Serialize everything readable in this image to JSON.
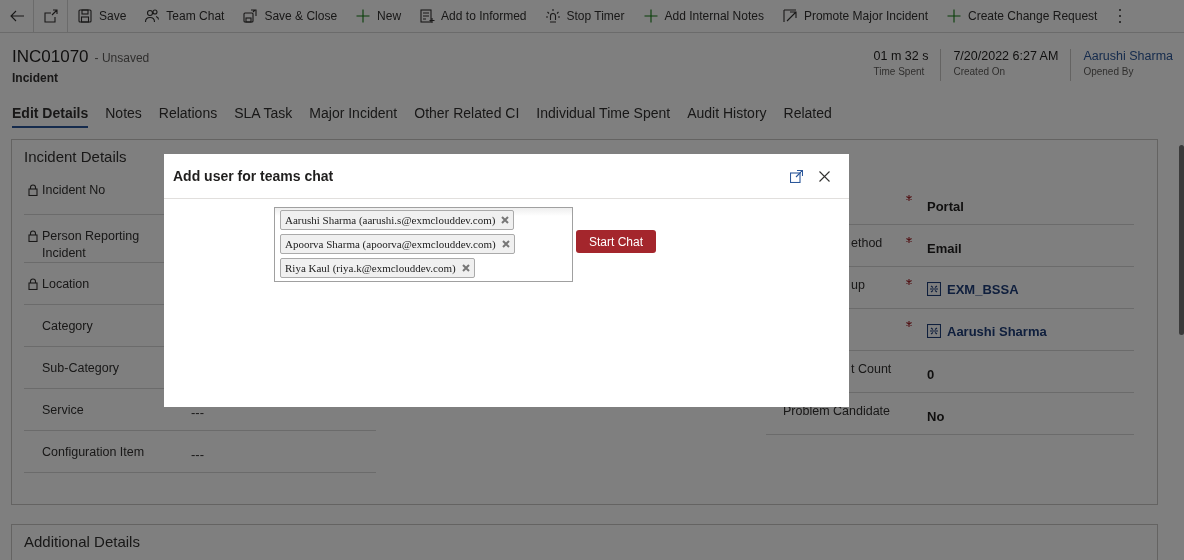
{
  "toolbar": {
    "items": [
      {
        "label": "Save"
      },
      {
        "label": "Team Chat"
      },
      {
        "label": "Save & Close"
      },
      {
        "label": "New"
      },
      {
        "label": "Add to Informed"
      },
      {
        "label": "Stop Timer"
      },
      {
        "label": "Add Internal Notes"
      },
      {
        "label": "Promote Major Incident"
      },
      {
        "label": "Create Change Request"
      }
    ]
  },
  "header": {
    "title": "INC01070",
    "save_status": "- Unsaved",
    "entity": "Incident",
    "fields": [
      {
        "value": "01 m 32 s",
        "label": "Time Spent",
        "kind": "text"
      },
      {
        "value": "7/20/2022 6:27 AM",
        "label": "Created On",
        "kind": "text"
      },
      {
        "value": "Aarushi Sharma",
        "label": "Opened By",
        "kind": "link"
      }
    ]
  },
  "tabs": [
    {
      "label": "Edit Details",
      "selected": true
    },
    {
      "label": "Notes",
      "selected": false
    },
    {
      "label": "Relations",
      "selected": false
    },
    {
      "label": "SLA Task",
      "selected": false
    },
    {
      "label": "Major Incident",
      "selected": false
    },
    {
      "label": "Other Related CI",
      "selected": false
    },
    {
      "label": "Individual Time Spent",
      "selected": false
    },
    {
      "label": "Audit History",
      "selected": false
    },
    {
      "label": "Related",
      "selected": false
    }
  ],
  "incident_details": {
    "title": "Incident Details",
    "left_fields": [
      {
        "label": "Incident No",
        "locked": true
      },
      {
        "label": "Person Reporting Incident",
        "locked": true
      },
      {
        "label": "Location",
        "locked": true
      },
      {
        "label": "Category",
        "locked": false
      },
      {
        "label": "Sub-Category",
        "locked": false
      },
      {
        "label": "Service",
        "locked": false,
        "value": "---"
      },
      {
        "label": "Configuration Item",
        "locked": false,
        "value": "---"
      }
    ],
    "right_fields": [
      {
        "required": true,
        "value": "Portal",
        "kind": "text"
      },
      {
        "label": "ethod",
        "clipped": true,
        "required": true,
        "value": "Email",
        "kind": "text"
      },
      {
        "label": "up",
        "clipped": true,
        "required": true,
        "value": "EXM_BSSA",
        "kind": "lookup"
      },
      {
        "required": true,
        "value": "Aarushi Sharma",
        "kind": "lookup"
      },
      {
        "label": "t Count",
        "clipped": true,
        "required": false,
        "value": "0",
        "kind": "text"
      },
      {
        "label": "Problem Candidate",
        "clipped": false,
        "required": false,
        "value": "No",
        "kind": "text"
      }
    ]
  },
  "additional_details": {
    "title": "Additional Details"
  },
  "dialog": {
    "title": "Add user for teams chat",
    "users": [
      {
        "label": "Aarushi Sharma (aarushi.s@exmclouddev.com)"
      },
      {
        "label": "Apoorva Sharma (apoorva@exmclouddev.com)"
      },
      {
        "label": "Riya Kaul (riya.k@exmclouddev.com)"
      }
    ],
    "button": "Start Chat"
  }
}
